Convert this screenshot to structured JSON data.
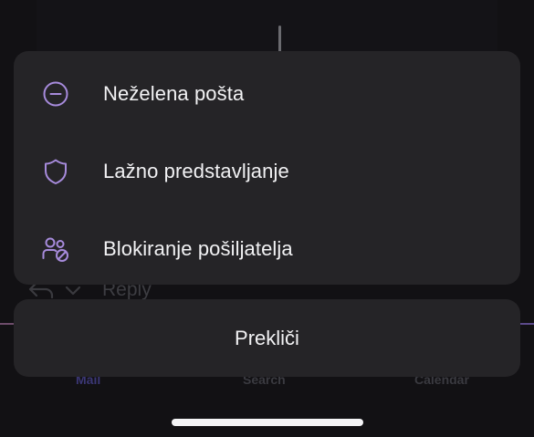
{
  "background": {
    "reply_label": "Reply",
    "tabs": [
      "Mail",
      "Search",
      "Calendar"
    ]
  },
  "action_sheet": {
    "items": [
      {
        "label": "Neželena pošta",
        "icon": "minus-circle-icon"
      },
      {
        "label": "Lažno predstavljanje",
        "icon": "shield-icon"
      },
      {
        "label": "Blokiranje pošiljatelja",
        "icon": "block-people-icon"
      }
    ],
    "cancel_label": "Prekliči"
  },
  "colors": {
    "sheet_bg": "#252427",
    "icon_accent": "#a78bdc",
    "text": "#f2f2f4"
  }
}
